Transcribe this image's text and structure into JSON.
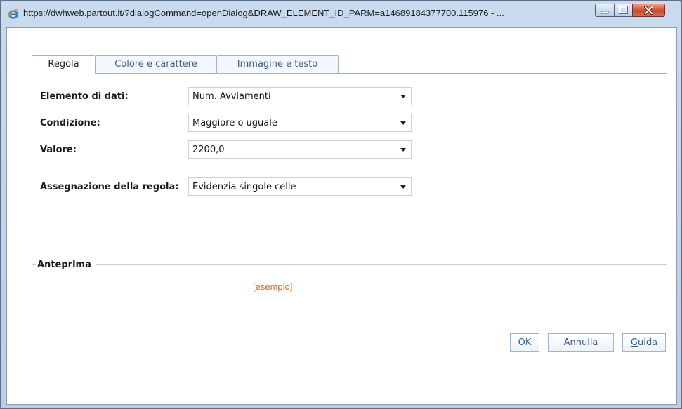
{
  "window": {
    "title": "https://dwhweb.partout.it/?dialogCommand=openDialog&DRAW_ELEMENT_ID_PARM=a14689184377700.115976 - ...",
    "icon": "ie-page-icon"
  },
  "tabs": [
    {
      "label": "Regola",
      "active": true
    },
    {
      "label": "Colore e carattere",
      "active": false
    },
    {
      "label": "Immagine e testo",
      "active": false
    }
  ],
  "rule": {
    "data_element": {
      "label": "Elemento di dati:",
      "value": "Num. Avviamenti"
    },
    "condition": {
      "label": "Condizione:",
      "value": "Maggiore o uguale"
    },
    "value": {
      "label": "Valore:",
      "value": "2200,0"
    },
    "assignment": {
      "label": "Assegnazione della regola:",
      "value": "Evidenzia singole celle"
    }
  },
  "preview": {
    "legend": "Anteprima",
    "sample": "[esempio]",
    "sample_color": "#e06a1a"
  },
  "buttons": {
    "ok": "OK",
    "cancel": "Annulla",
    "help_first": "G",
    "help_rest": "uida"
  }
}
